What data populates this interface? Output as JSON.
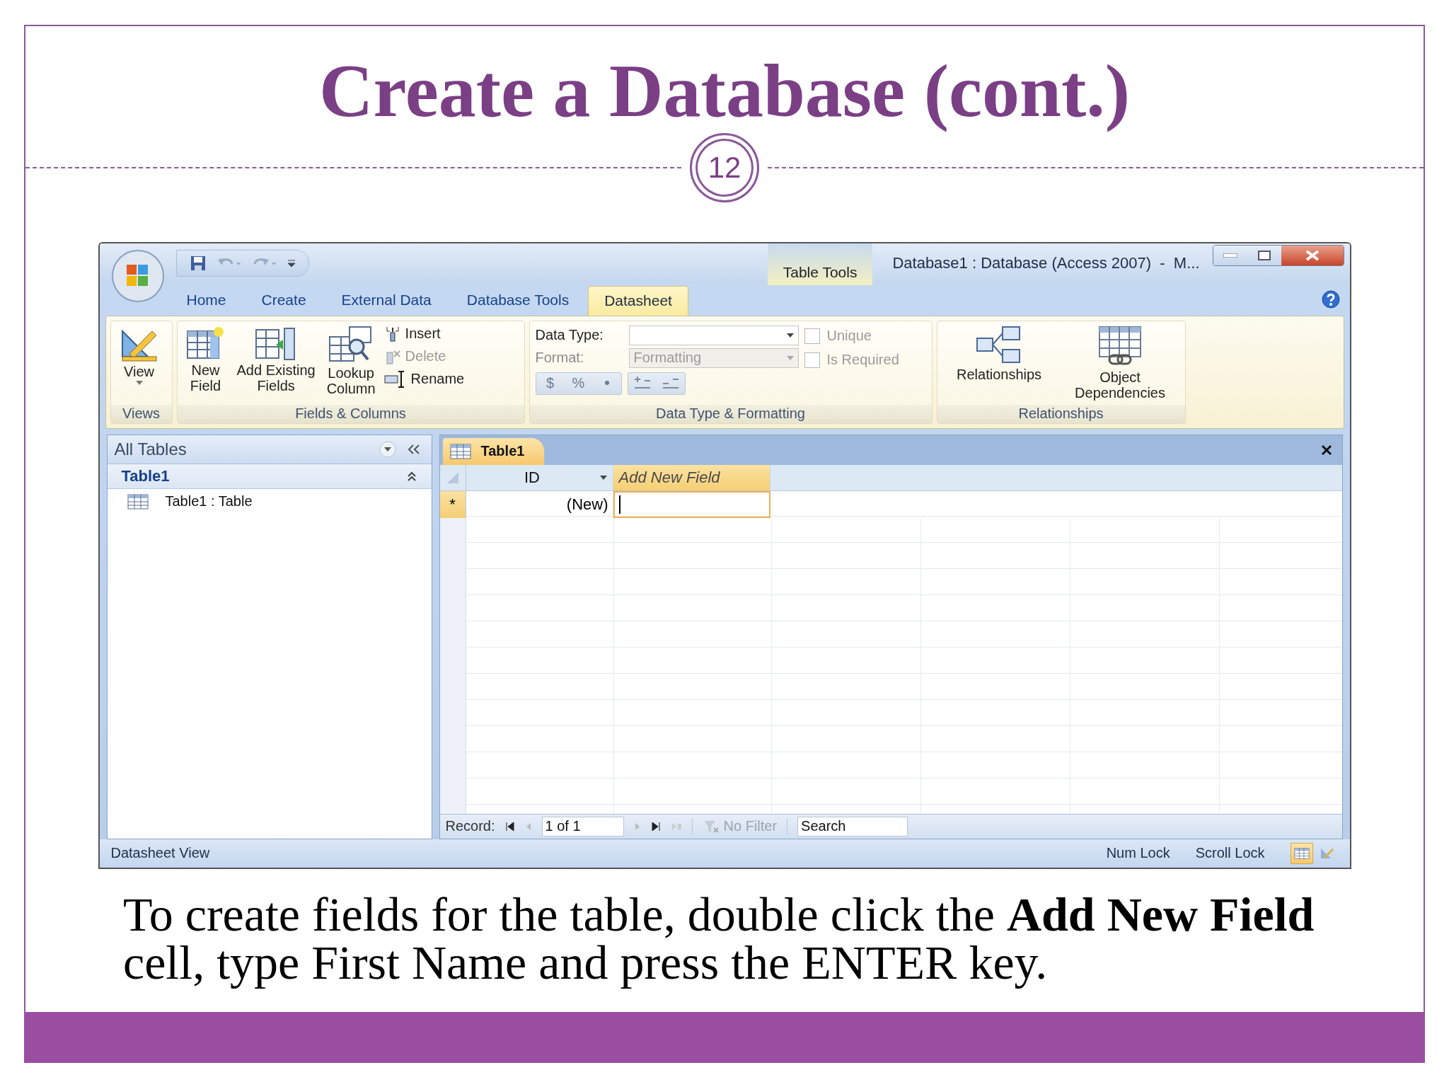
{
  "slide": {
    "title": "Create a Database (cont.)",
    "number": "12",
    "caption": "To create fields for the table, double click the **Add New Field** cell, type First Name and press the ENTER key."
  },
  "window": {
    "contextual_group": "Table Tools",
    "title": "Database1 : Database (Access 2007)  -  M..."
  },
  "tabs": [
    {
      "label": "Home",
      "selected": false
    },
    {
      "label": "Create",
      "selected": false
    },
    {
      "label": "External Data",
      "selected": false
    },
    {
      "label": "Database Tools",
      "selected": false
    },
    {
      "label": "Datasheet",
      "selected": true
    }
  ],
  "ribbon": {
    "views": {
      "label": "Views",
      "button": "View"
    },
    "fields": {
      "label": "Fields & Columns",
      "large": [
        "New\nField",
        "Add Existing\nFields",
        "Lookup\nColumn"
      ],
      "small": [
        {
          "label": "Insert",
          "disabled": false
        },
        {
          "label": "Delete",
          "disabled": true
        },
        {
          "label": "Rename",
          "disabled": false
        }
      ]
    },
    "formatting": {
      "label": "Data Type & Formatting",
      "data_type_label": "Data Type:",
      "format_label": "Format:",
      "format_value": "Formatting",
      "format_disabled": true,
      "currency": "$",
      "percent": "%",
      "checkboxes": [
        {
          "label": "Unique",
          "checked": false,
          "disabled": true
        },
        {
          "label": "Is Required",
          "checked": false,
          "disabled": true
        }
      ]
    },
    "relationships": {
      "label": "Relationships",
      "buttons": [
        "Relationships",
        "Object\nDependencies"
      ]
    }
  },
  "navigation": {
    "header": "All Tables",
    "group": "Table1",
    "items": [
      "Table1 : Table"
    ]
  },
  "document_tabs": [
    {
      "label": "Table1",
      "selected": true
    }
  ],
  "table": {
    "columns": [
      {
        "label": "ID",
        "dropdown": true,
        "selected": false
      },
      {
        "label": "Add New Field",
        "dropdown": false,
        "selected": true
      }
    ],
    "rows": [
      {
        "selector": "*",
        "cells": [
          "(New)",
          ""
        ]
      }
    ]
  },
  "record_nav": {
    "label": "Record:",
    "position": "1 of 1",
    "filter": "No Filter",
    "search": "Search"
  },
  "status_bar": {
    "view": "Datasheet View",
    "indicators": [
      "Num Lock",
      "Scroll Lock"
    ]
  }
}
